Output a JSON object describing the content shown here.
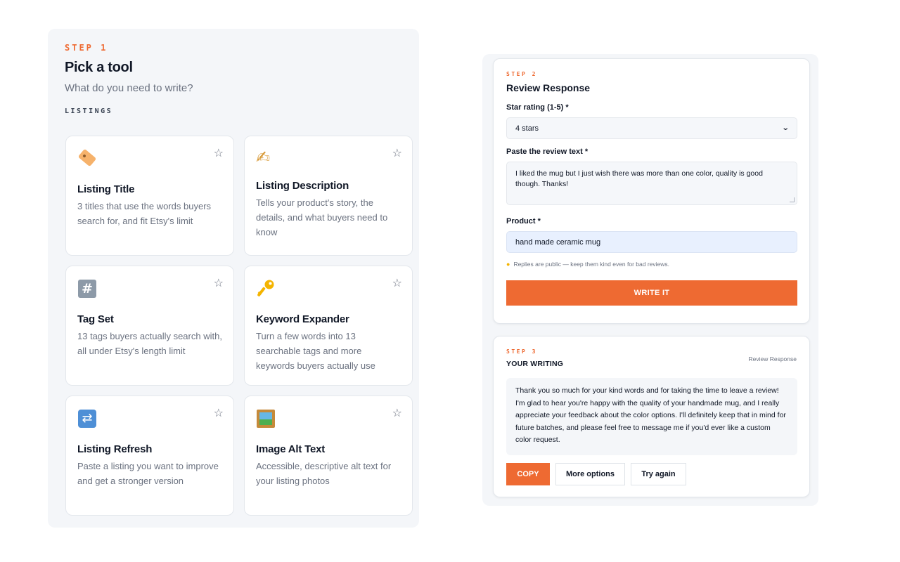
{
  "step1": {
    "label": "STEP 1",
    "title": "Pick a tool",
    "subtitle": "What do you need to write?",
    "section": "LISTINGS",
    "tools": [
      {
        "name": "Listing Title",
        "desc": "3 titles that use the words buyers search for, and fit Etsy's limit",
        "icon": "label-tag-icon"
      },
      {
        "name": "Listing Description",
        "desc": "Tells your product's story, the details, and what buyers need to know",
        "icon": "writing-hand-icon"
      },
      {
        "name": "Tag Set",
        "desc": "13 tags buyers actually search with, all under Etsy's length limit",
        "icon": "hash-icon"
      },
      {
        "name": "Keyword Expander",
        "desc": "Turn a few words into 13 searchable tags and more keywords buyers actually use",
        "icon": "key-icon"
      },
      {
        "name": "Listing Refresh",
        "desc": "Paste a listing you want to improve and get a stronger version",
        "icon": "refresh-icon"
      },
      {
        "name": "Image Alt Text",
        "desc": "Accessible, descriptive alt text for your listing photos",
        "icon": "framed-picture-icon"
      }
    ],
    "star_glyph": "☆"
  },
  "step2": {
    "label": "STEP 2",
    "title": "Review Response",
    "rating_label": "Star rating (1-5) *",
    "rating_value": "4 stars",
    "review_label": "Paste the review text *",
    "review_value": "I liked the mug but I just wish there was more than one color, quality is good though. Thanks!",
    "product_label": "Product *",
    "product_value": "hand made ceramic mug",
    "hint": "Replies are public — keep them kind even for bad reviews.",
    "submit_label": "WRITE IT"
  },
  "step3": {
    "label": "STEP 3",
    "title": "YOUR WRITING",
    "tool_name": "Review Response",
    "output": "Thank you so much for your kind words and for taking the time to leave a review! I'm glad to hear you're happy with the quality of your handmade mug, and I really appreciate your feedback about the color options. I'll definitely keep that in mind for future batches, and please feel free to message me if you'd ever like a custom color request.",
    "copy_label": "COPY",
    "more_label": "More options",
    "retry_label": "Try again"
  },
  "colors": {
    "accent": "#ee6a32",
    "panel_bg": "#f4f6f9",
    "input_highlight": "#e8f0fe"
  }
}
